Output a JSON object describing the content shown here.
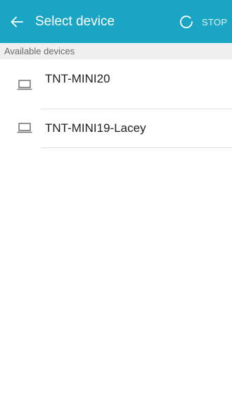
{
  "header": {
    "title": "Select device",
    "stop_label": "STOP",
    "bar_color": "#1ba5c5"
  },
  "section": {
    "title": "Available devices"
  },
  "devices": [
    {
      "name": "TNT-MINI20",
      "icon": "laptop-icon"
    },
    {
      "name": "TNT-MINI19-Lacey",
      "icon": "laptop-icon"
    }
  ]
}
